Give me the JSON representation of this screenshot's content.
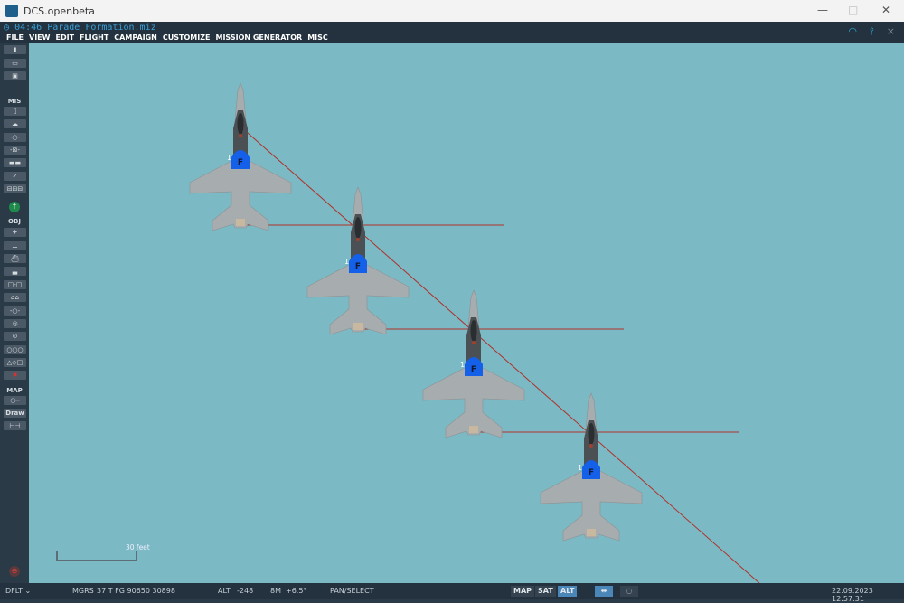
{
  "window": {
    "title": "DCS.openbeta",
    "minimize": "—",
    "maximize": "□",
    "close": "✕"
  },
  "app": {
    "mission_time": "04:46",
    "mission_file": "Parade Formation.miz",
    "close": "×"
  },
  "menu": [
    "FILE",
    "VIEW",
    "EDIT",
    "FLIGHT",
    "CAMPAIGN",
    "CUSTOMIZE",
    "MISSION GENERATOR",
    "MISC"
  ],
  "sidebar": {
    "mis_label": "MIS",
    "obj_label": "OBJ",
    "map_label": "MAP",
    "draw_label": "Draw"
  },
  "map": {
    "scale_label": "30 feet",
    "unit_number": "1",
    "unit_letter": "F",
    "route_color": "#b0302a",
    "map_color": "#7bbac4"
  },
  "status": {
    "profile": "DFLT",
    "coord_system": "MGRS",
    "coordinates": "37 T FG 90650 30898",
    "alt_label": "ALT",
    "alt_value": "-248",
    "mag_label": "8M",
    "mag_value": "+6.5°",
    "mode": "PAN/SELECT",
    "map_btn": "MAP",
    "sat_btn": "SAT",
    "alt_btn": "ALT",
    "datetime": "22.09.2023 12:57:31"
  }
}
